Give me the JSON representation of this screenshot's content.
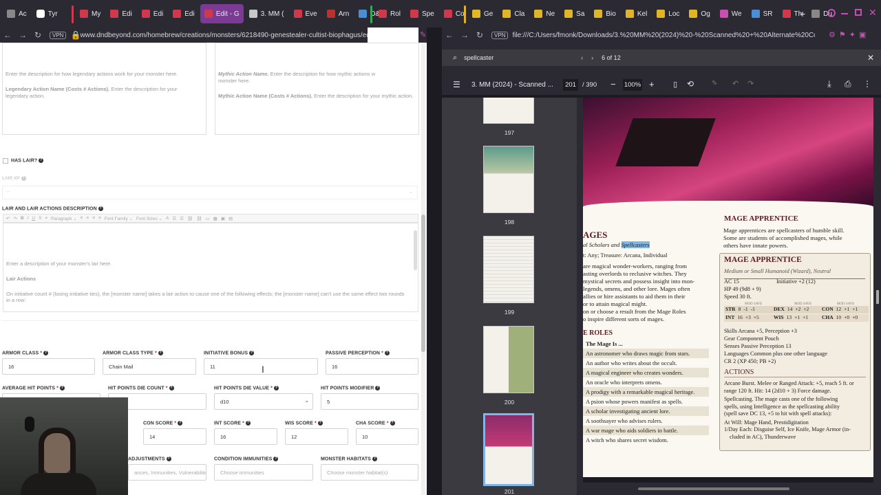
{
  "tabs": {
    "group1": [
      {
        "label": "Tyr"
      },
      {
        "label": "Ac"
      },
      {
        "label": "Tyr"
      }
    ],
    "group2": [
      {
        "label": "My"
      },
      {
        "label": "Edi"
      },
      {
        "label": "Edi"
      },
      {
        "label": "Edi"
      },
      {
        "label": "Edit - G",
        "active": true
      },
      {
        "label": "3. MM ("
      },
      {
        "label": "Eve"
      },
      {
        "label": "Arn"
      },
      {
        "label": "D&"
      }
    ],
    "group3": [
      {
        "label": "Rol"
      },
      {
        "label": "Spe"
      },
      {
        "label": "Co"
      }
    ],
    "group4": [
      {
        "label": "Ge"
      },
      {
        "label": "Cla"
      },
      {
        "label": "Ne"
      },
      {
        "label": "Sa"
      },
      {
        "label": "Bio"
      },
      {
        "label": "Kel"
      },
      {
        "label": "Loc"
      },
      {
        "label": "Og"
      },
      {
        "label": "We"
      },
      {
        "label": "SR"
      },
      {
        "label": "Th"
      },
      {
        "label": "Du"
      }
    ],
    "new_tab": "+"
  },
  "left_url": "www.dndbeyond.com/homebrew/creations/monsters/6218490-genestealer-cultist-biophagus/edit",
  "right_url": "file:///C:/Users/fmonk/Downloads/3.%20MM%20(2024)%20-%20Scanned%20+%20Alternate%20Cc",
  "vpn": "VPN",
  "form": {
    "legendary_desc": "Enter the description for how legendary actions work for your monster here.",
    "legendary_action_name": "Legendary Action Name (Costs # Actions).",
    "legendary_action_desc": "Enter the description for your legendary action.",
    "mythic_action_name": "Mythic Action Name.",
    "mythic_desc": "Enter the description for how mythic actions w monster here.",
    "mythic_action_name2": "Mythic Action Name (Costs # Actions).",
    "mythic_action_desc": "Enter the description for your mythic action.",
    "has_lair": "HAS LAIR?",
    "lair_xp": "LAIR XP",
    "lair_xp_value": "--",
    "lair_desc_label": "LAIR AND LAIR ACTIONS DESCRIPTION",
    "toolbar": {
      "paragraph": "Paragraph",
      "font_family": "Font Family",
      "font_sizes": "Font Sizes"
    },
    "lair_placeholder": "Enter a description of your monster's lair here.",
    "lair_actions": "Lair Actions",
    "lair_actions_text": "On initiative count # (losing initiative ties), the [monster name] takes a lair action to cause one of the following effects; the [monster name] can't use the same effect two rounds in a row:",
    "armor_class_label": "ARMOR CLASS",
    "armor_class": "16",
    "armor_class_type_label": "ARMOR CLASS TYPE",
    "armor_class_type": "Chain Mail",
    "initiative_bonus_label": "INITIATIVE BONUS",
    "initiative_bonus": "11",
    "passive_perception_label": "PASSIVE PERCEPTION",
    "passive_perception": "16",
    "avg_hp_label": "AVERAGE HIT POINTS",
    "hp_die_count_label": "HIT POINTS DIE COUNT",
    "hp_die_value_label": "HIT POINTS DIE VALUE",
    "hp_die_value": "d10",
    "hp_modifier_label": "HIT POINTS MODIFIER",
    "hp_modifier": "5",
    "con_label": "CON SCORE",
    "con": "14",
    "int_label": "INT SCORE",
    "int": "16",
    "wis_label": "WIS SCORE",
    "wis": "12",
    "cha_label": "CHA SCORE",
    "cha": "10",
    "adjustments_label": "ADJUSTMENTS",
    "adjustments_ph": "ances, Immunities, Vulnerabilities, etc.",
    "condition_immunities_label": "CONDITION IMMUNITIES",
    "condition_immunities_ph": "Choose immunities",
    "habitats_label": "MONSTER HABITATS",
    "habitats_ph": "Choose monster habitat(s)"
  },
  "pdf": {
    "search_value": "spellcaster",
    "match_count": "6 of 12",
    "title": "3. MM (2024) - Scanned ...",
    "page": "201",
    "total_pages": "/ 390",
    "zoom": "100%",
    "thumb_pages": [
      "197",
      "198",
      "199",
      "200",
      "201"
    ]
  },
  "page_content": {
    "heading_left": "AGES",
    "subtitle_a": "al Scholars and ",
    "subtitle_highlight": "Spellcasters",
    "treasure": "t: Any; Treasure: Arcana, Individual",
    "intro": [
      "are magical wonder-workers, ranging from",
      "asting overlords to reclusive witches. They",
      "mystical secrets and possess insight into mon-",
      "legends, omens, and other lore. Mages often",
      "allies or hire assistants to aid them in their",
      "or to attain magical might.",
      "on or choose a result from the Mage Roles",
      "o inspire different sorts of mages."
    ],
    "roles_heading": "E ROLES",
    "roles_col": "The Mage Is ...",
    "roles": [
      "An astronomer who draws magic from stars.",
      "An author who writes about the occult.",
      "A magical engineer who creates wonders.",
      "An oracle who interprets omens.",
      "A prodigy with a remarkable magical heritage.",
      "A psion whose powers manifest as spells.",
      "A scholar investigating ancient lore.",
      "A soothsayer who advises rulers.",
      "A war mage who aids soldiers in battle.",
      "A witch who shares secret wisdom."
    ],
    "mage_apprentice_heading": "MAGE APPRENTICE",
    "mage_apprentice_text": [
      "Mage apprentices are spellcasters of humble skill.",
      "Some are students of accomplished mages, while",
      "others have innate powers."
    ],
    "statblock": {
      "name": "MAGE APPRENTICE",
      "type": "Medium or Small Humanoid (Wizard), Neutral",
      "ac": "AC 15",
      "initiative": "Initiative +2 (12)",
      "hp": "HP 49 (9d8 + 9)",
      "speed": "Speed 30 ft.",
      "mod_save": "MOD SAVE",
      "abilities": [
        {
          "name": "STR",
          "score": "8",
          "mod": "-1",
          "save": "-1"
        },
        {
          "name": "DEX",
          "score": "14",
          "mod": "+2",
          "save": "+2"
        },
        {
          "name": "CON",
          "score": "12",
          "mod": "+1",
          "save": "+1"
        },
        {
          "name": "INT",
          "score": "16",
          "mod": "+3",
          "save": "+5"
        },
        {
          "name": "WIS",
          "score": "13",
          "mod": "+1",
          "save": "+1"
        },
        {
          "name": "CHA",
          "score": "10",
          "mod": "+0",
          "save": "+0"
        }
      ],
      "skills": "Skills Arcana +5, Perception +3",
      "gear": "Gear Component Pouch",
      "senses": "Senses Passive Perception 13",
      "languages": "Languages Common plus one other language",
      "cr": "CR 2 (XP 450; PB +2)",
      "actions_heading": "ACTIONS",
      "actions": [
        "Arcane Burst. Melee or Ranged Attack: +5, reach 5 ft. or",
        "range 120 ft. Hit: 14 (2d10 + 3) Force damage.",
        "Spellcasting. The mage casts one of the following",
        "spells, using Intelligence as the spellcasting ability",
        "(spell save DC 13, +5 to hit with spell attacks):",
        "At Will: Mage Hand, Prestidigitation",
        "1/Day Each: Disguise Self, Ice Knife, Mage Armor (in-",
        "cluded in AC), Thunderwave"
      ]
    }
  },
  "colors": {
    "tab_active": "#7b3a93",
    "group_red": "#d0384c",
    "group_green": "#3aa55c",
    "group_yellow": "#e0b526",
    "highlight": "#7fb7e6"
  }
}
